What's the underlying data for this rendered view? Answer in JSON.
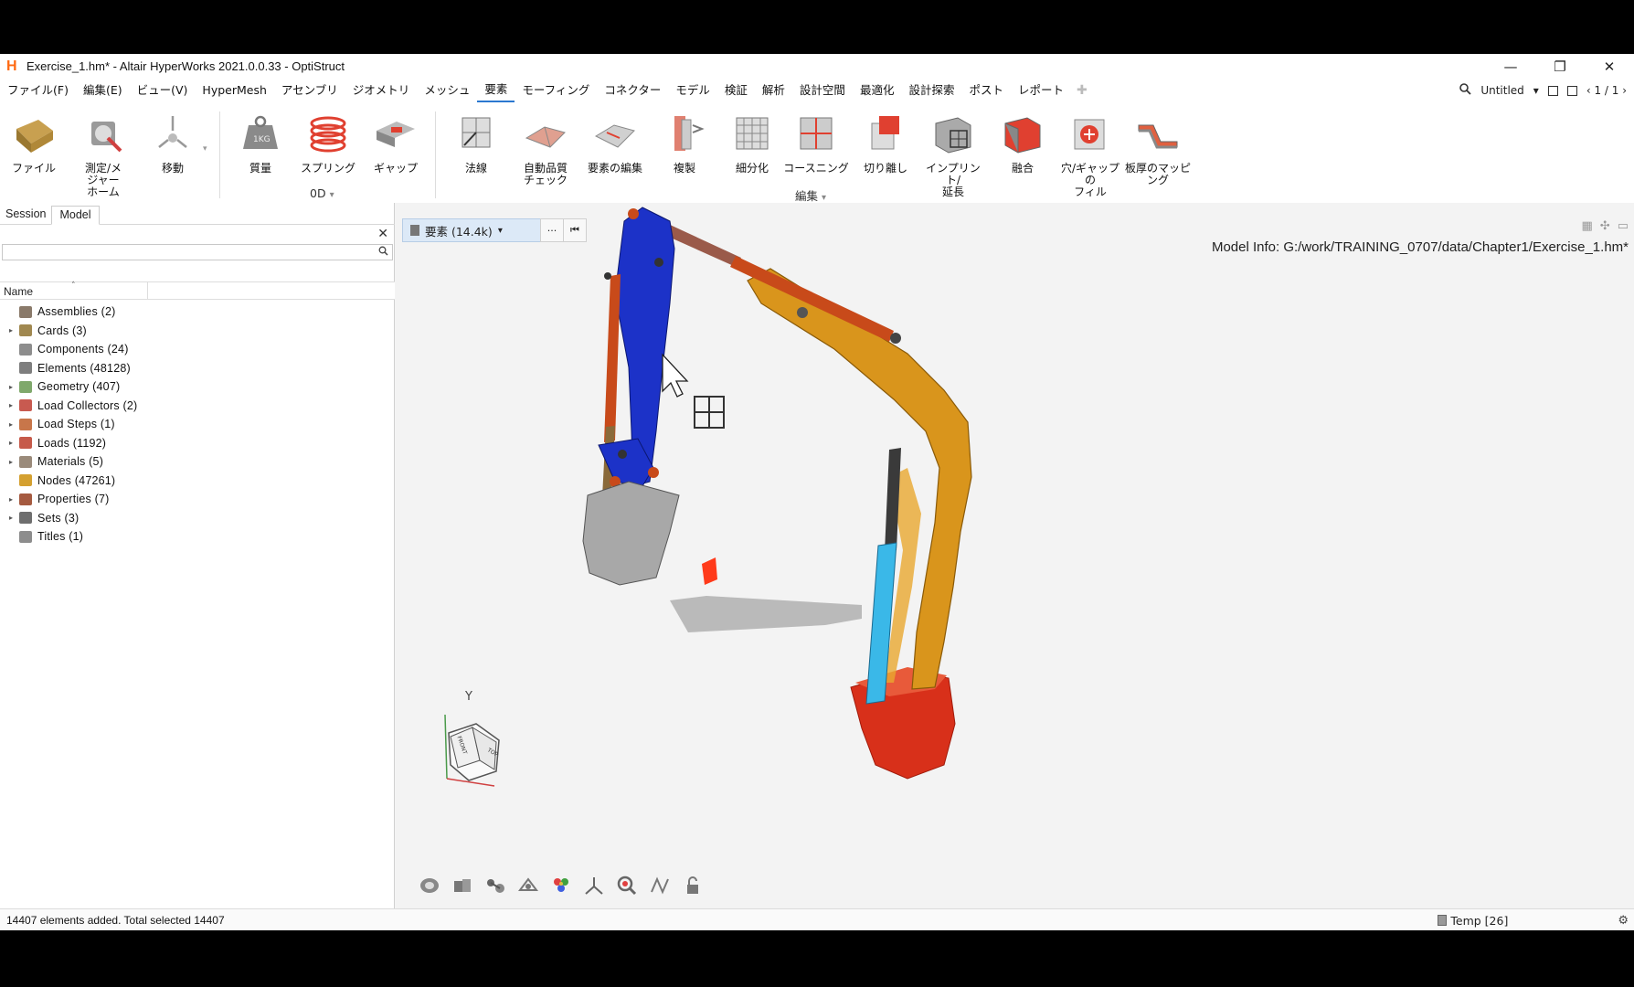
{
  "window": {
    "title": "Exercise_1.hm* - Altair HyperWorks 2021.0.0.33 - OptiStruct",
    "logo_letter": "H",
    "minimize": "—",
    "restore": "❐",
    "close": "✕"
  },
  "menu": {
    "items": [
      "ファイル(F)",
      "編集(E)",
      "ビュー(V)",
      "HyperMesh",
      "アセンブリ",
      "ジオメトリ",
      "メッシュ",
      "要素",
      "モーフィング",
      "コネクター",
      "モデル",
      "検証",
      "解析",
      "設計空間",
      "最適化",
      "設計探索",
      "ポスト",
      "レポート"
    ],
    "active_index": 7,
    "add": "✚",
    "right": {
      "search_icon": "search-icon",
      "session": "Untitled",
      "session_caret": "▾",
      "pages": "‹ 1 / 1 ›"
    }
  },
  "ribbon": {
    "tools": [
      {
        "label": "ファイル",
        "icon": "file-folder-icon"
      },
      {
        "label": "測定/メ\nジャー\nホーム",
        "icon": "measure-icon"
      },
      {
        "label": "移動",
        "icon": "move-icon"
      },
      {
        "label": "質量",
        "icon": "mass-weight-icon"
      },
      {
        "label": "スプリング",
        "icon": "spring-icon"
      },
      {
        "label": "ギャップ",
        "icon": "gap-icon"
      },
      {
        "label": "法線",
        "icon": "normal-icon"
      },
      {
        "label": "自動品質\nチェック",
        "icon": "auto-quality-icon"
      },
      {
        "label": "要素の編集",
        "icon": "edit-elements-icon"
      },
      {
        "label": "複製",
        "icon": "duplicate-icon"
      },
      {
        "label": "細分化",
        "icon": "refine-icon"
      },
      {
        "label": "コースニング",
        "icon": "coarsen-icon"
      },
      {
        "label": "切り離し",
        "icon": "detach-icon"
      },
      {
        "label": "インプリント/\n延長",
        "icon": "imprint-icon"
      },
      {
        "label": "融合",
        "icon": "fuse-icon"
      },
      {
        "label": "穴/ギャップの\nフィル",
        "icon": "fill-hole-icon"
      },
      {
        "label": "板厚のマッピ\nング",
        "icon": "thickness-map-icon"
      }
    ],
    "groups": {
      "zero_d": "0D",
      "edit": "編集",
      "caret": "▾"
    }
  },
  "left_panel": {
    "tabs": [
      "Session",
      "Model"
    ],
    "active_tab": 1,
    "close": "✕",
    "column_name": "Name",
    "sort_glyph": "˄",
    "tree": [
      {
        "label": "Assemblies  (2)",
        "expandable": false,
        "color": "#8a7a6a"
      },
      {
        "label": "Cards  (3)",
        "expandable": true,
        "color": "#a08850"
      },
      {
        "label": "Components  (24)",
        "expandable": false,
        "color": "#8d8d8d"
      },
      {
        "label": "Elements  (48128)",
        "expandable": false,
        "color": "#7e7e7e"
      },
      {
        "label": "Geometry  (407)",
        "expandable": true,
        "color": "#7fa86b"
      },
      {
        "label": "Load Collectors  (2)",
        "expandable": true,
        "color": "#c85a50"
      },
      {
        "label": "Load Steps  (1)",
        "expandable": true,
        "color": "#c8764a"
      },
      {
        "label": "Loads  (1192)",
        "expandable": true,
        "color": "#c65a4a"
      },
      {
        "label": "Materials  (5)",
        "expandable": true,
        "color": "#9a8a7a"
      },
      {
        "label": "Nodes  (47261)",
        "expandable": false,
        "color": "#d4a030"
      },
      {
        "label": "Properties  (7)",
        "expandable": true,
        "color": "#a55a40"
      },
      {
        "label": "Sets  (3)",
        "expandable": true,
        "color": "#6e6e6e"
      },
      {
        "label": "Titles  (1)",
        "expandable": false,
        "color": "#8d8d8d"
      }
    ]
  },
  "viewport": {
    "entity_selector": "要素 (14.4k)",
    "entity_caret": "▾",
    "more_btn": "···",
    "reset_btn": "⏮",
    "model_info": "Model Info: G:/work/TRAINING_0707/data/Chapter1/Exercise_1.hm*",
    "axis_label": "Y",
    "cube_face_front": "FRONT",
    "cube_face_top": "TOP",
    "bottom_tools": [
      "shaded-view-icon",
      "components-view-icon",
      "connectors-view-icon",
      "visualization-icon",
      "color-by-icon",
      "axis-triad-icon",
      "zoom-fit-icon",
      "view-transform-icon",
      "lock-view-icon"
    ]
  },
  "status": {
    "message": "14407 elements added. Total selected 14407",
    "temp": "Temp [26]"
  },
  "colors": {
    "boom": "#d9951c",
    "arm": "#1c32c8",
    "bucket": "#a8a8a8",
    "rod_red": "#c84a1a",
    "cylinder_cyan": "#3ab8e8",
    "base_red": "#d8301a",
    "accent": "#2b78d0"
  }
}
